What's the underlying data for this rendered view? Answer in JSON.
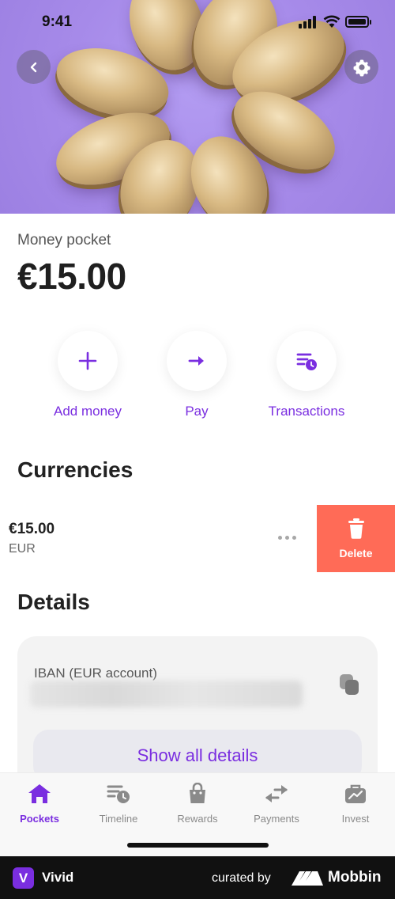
{
  "status_bar": {
    "time": "9:41"
  },
  "balance": {
    "label": "Money pocket",
    "amount": "€15.00"
  },
  "actions": [
    {
      "label": "Add money",
      "icon": "plus-icon"
    },
    {
      "label": "Pay",
      "icon": "arrow-right-icon"
    },
    {
      "label": "Transactions",
      "icon": "transactions-icon"
    }
  ],
  "currencies": {
    "title": "Currencies",
    "items": [
      {
        "amount": "€15.00",
        "code": "EUR",
        "delete_label": "Delete"
      }
    ]
  },
  "details": {
    "title": "Details",
    "iban_label": "IBAN (EUR account)",
    "show_all_label": "Show all details"
  },
  "tabs": [
    {
      "label": "Pockets",
      "icon": "home-icon",
      "active": true
    },
    {
      "label": "Timeline",
      "icon": "timeline-icon",
      "active": false
    },
    {
      "label": "Rewards",
      "icon": "shopping-bag-icon",
      "active": false
    },
    {
      "label": "Payments",
      "icon": "transfer-arrows-icon",
      "active": false
    },
    {
      "label": "Invest",
      "icon": "invest-briefcase-icon",
      "active": false
    }
  ],
  "footer": {
    "app_name": "Vivid",
    "app_initial": "V",
    "curated_by": "curated by",
    "brand": "Mobbin"
  },
  "colors": {
    "accent": "#7a2ee0",
    "delete": "#ff6b57",
    "hero": "#a68ae9"
  }
}
